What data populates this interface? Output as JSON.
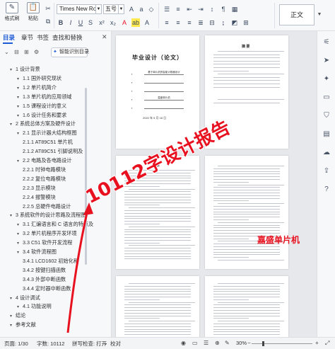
{
  "ribbon": {
    "format_painter": "格式刷",
    "paste": "粘贴",
    "font_name": "Times New Roma",
    "font_size": "五号",
    "style_normal": "正文"
  },
  "sidebar": {
    "tabs": [
      "目录",
      "章节",
      "书签",
      "查找和替换"
    ],
    "smart_toc_label": "智能识别目录",
    "toc": [
      {
        "label": "1 设计背景",
        "level": 1
      },
      {
        "label": "1.1 国外研究现状",
        "level": 2
      },
      {
        "label": "1.2 单片机简介",
        "level": 2
      },
      {
        "label": "1.3 单片机的应用领域",
        "level": 2
      },
      {
        "label": "1.5 课程设计的意义",
        "level": 2
      },
      {
        "label": "1.6 设计任务和要求",
        "level": 2
      },
      {
        "label": "2 系统总体方案及硬件设计",
        "level": 1
      },
      {
        "label": "2.1 显示计器大结构框图",
        "level": 2
      },
      {
        "label": "2.1.1 AT89C51 单片机",
        "level": 3
      },
      {
        "label": "2.1.2 AT89C51 引脚说明及",
        "level": 3
      },
      {
        "label": "2.2 电路及各电路设计",
        "level": 2
      },
      {
        "label": "2.2.1 时钟电路模块",
        "level": 3
      },
      {
        "label": "2.2.2 复位电路模块",
        "level": 3
      },
      {
        "label": "2.2.3 显示模块",
        "level": 3
      },
      {
        "label": "2.2.4 报警模块",
        "level": 3
      },
      {
        "label": "2.2.5 总硬件电路设计",
        "level": 3
      },
      {
        "label": "3 系统软件的设计思路及流程图",
        "level": 1
      },
      {
        "label": "3.1 汇编语言和 C 语言的特点及",
        "level": 2
      },
      {
        "label": "3.2 单片机程序开发环境",
        "level": 2
      },
      {
        "label": "3.3 C51 软件开发流程",
        "level": 2
      },
      {
        "label": "3.4 软件流程图",
        "level": 2
      },
      {
        "label": "3.4.1 LCD1602 初始化和",
        "level": 3
      },
      {
        "label": "3.4.2 按键扫描函数",
        "level": 3
      },
      {
        "label": "3.4.3 外部中断函数",
        "level": 3
      },
      {
        "label": "3.4.4 定时器中断函数",
        "level": 3
      },
      {
        "label": "4 设计调试",
        "level": 1
      },
      {
        "label": "4.1 功能说明",
        "level": 2
      },
      {
        "label": "结论",
        "level": 1
      },
      {
        "label": "参考文献",
        "level": 1
      }
    ]
  },
  "document": {
    "cover_title": "毕业设计（论文）",
    "cover_fields": [
      "基于单片机的智能计数器设计",
      "嘉盛单片机",
      "",
      "",
      ""
    ],
    "cover_date": "2022 年 5 月 18 日",
    "abstract_title": "摘 要",
    "toc_title": "目录"
  },
  "overlay": {
    "headline": "10112字设计报告",
    "watermark": "嘉盛单片机"
  },
  "statusbar": {
    "page": "页面: 1/30",
    "words": "字数: 10112",
    "spell": "拼写检查: 打开",
    "proof": "校对",
    "zoom": "30%"
  },
  "colors": {
    "accent": "#1d5bd8",
    "overlay_red": "#e8111f"
  }
}
